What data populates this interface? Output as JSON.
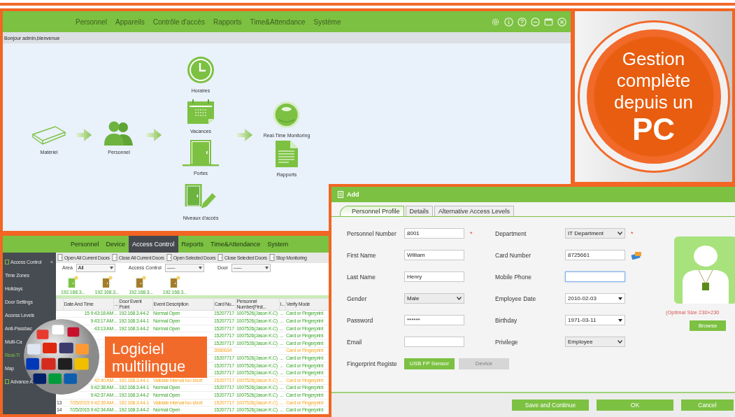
{
  "main_window": {
    "menu": [
      "Personnel",
      "Appareils",
      "Contrôle d'accès",
      "Rapports",
      "Time&Attendance",
      "Système"
    ],
    "greeting": "Bonjour admin,bienvenue",
    "flow_nodes": [
      {
        "label": "Matériel",
        "kind": "device"
      },
      {
        "label": "Personnel",
        "kind": "people"
      },
      {
        "label": "Horaires",
        "kind": "clock"
      },
      {
        "label": "Vacances",
        "kind": "calendar"
      },
      {
        "label": "Portes",
        "kind": "door"
      },
      {
        "label": "Niveaux d'accès",
        "kind": "door-edit"
      },
      {
        "label": "Real-Time Monitoring",
        "kind": "monitor"
      },
      {
        "label": "Rapports",
        "kind": "report"
      }
    ]
  },
  "promo_badge": {
    "text": "Gestion complète depuis un",
    "highlight": "PC"
  },
  "monitor_window": {
    "menu": [
      {
        "label": "Personnel",
        "selected": false
      },
      {
        "label": "Device",
        "selected": false
      },
      {
        "label": "Access Control",
        "selected": true
      },
      {
        "label": "Reports",
        "selected": false
      },
      {
        "label": "Time&Attendance",
        "selected": false
      },
      {
        "label": "System",
        "selected": false
      }
    ],
    "sidebar": [
      {
        "label": "Access Control",
        "kind": "header",
        "toggle": "«",
        "selected": false
      },
      {
        "label": "Time Zones",
        "kind": "item",
        "selected": false
      },
      {
        "label": "Holidays",
        "kind": "item",
        "selected": false
      },
      {
        "label": "Door Settings",
        "kind": "item",
        "selected": false
      },
      {
        "label": "Access Levels",
        "kind": "item",
        "selected": false
      },
      {
        "label": "Anti-Passbac",
        "kind": "item",
        "selected": false
      },
      {
        "label": "Multi-Ca",
        "kind": "item",
        "selected": false
      },
      {
        "label": "Real-Ti",
        "kind": "item",
        "selected": true
      },
      {
        "label": "Map",
        "kind": "item",
        "selected": false
      },
      {
        "label": "Advance A",
        "kind": "header",
        "selected": false
      }
    ],
    "toolbar": [
      "Open All Current Doors",
      "Close All Current Doors",
      "Open Selected Doors",
      "Close Selected Doors",
      "Stop Monitoring"
    ],
    "filters": [
      {
        "label": "Area",
        "value": "All"
      },
      {
        "label": "Access Control",
        "value": "-----"
      },
      {
        "label": "Door",
        "value": "-----"
      }
    ],
    "doors": [
      {
        "label": "192.168.3...",
        "color": "#7cc142"
      },
      {
        "label": "192.168.3...",
        "color": "#a57b2c"
      },
      {
        "label": "192.168.3...",
        "color": "#a57b2c"
      },
      {
        "label": "192.168.3...",
        "color": "#a57b2c"
      }
    ],
    "columns": [
      "Date And Time",
      "...",
      "Door Event Point",
      "Event Description",
      "Card Nu...",
      "Personnel Number(First...",
      "I...",
      "Verify Mode"
    ],
    "rows": [
      {
        "kind": "normal",
        "date": "15 9:43:18 AM",
        "sep": "...",
        "door": "192.168.3.44-2",
        "event": "Normal Open",
        "card": "15207717",
        "person": "1007526(Jason K.C)",
        "flag": "...",
        "verify": "Card or Fingerprint"
      },
      {
        "kind": "normal",
        "date": "9:43:17 AM",
        "sep": "...",
        "door": "192.168.3.44-1",
        "event": "Normal Open",
        "card": "15207717",
        "person": "1007526(Jason K.C)",
        "flag": "...",
        "verify": "Card or Fingerprint"
      },
      {
        "kind": "normal",
        "date": "43:13 AM",
        "sep": "...",
        "door": "192.168.3.44-2",
        "event": "Normal Open",
        "card": "15207717",
        "person": "1007526(Jason K.C)",
        "flag": "...",
        "verify": "Card or Fingerprint"
      },
      {
        "kind": "normal",
        "card": "15207717",
        "person": "1007526(Jason K.C)",
        "flag": "...",
        "verify": "Card or Fingerprint"
      },
      {
        "kind": "normal",
        "card": "15207717",
        "person": "1007526(Jason K.C)",
        "flag": "...",
        "verify": "Card or Fingerprint"
      },
      {
        "kind": "alert",
        "card": "3080634",
        "verify": "Card or Fingerprint"
      },
      {
        "kind": "normal",
        "card": "15207717",
        "person": "1007526(Jason K.C)",
        "flag": "...",
        "verify": "Card or Fingerprint"
      },
      {
        "kind": "normal",
        "card": "15207717",
        "person": "1007526(Jason K.C)",
        "flag": "...",
        "verify": "Card or Fingerprint"
      },
      {
        "kind": "normal",
        "card": "15207717",
        "person": "1007526(Jason K.C)",
        "flag": "...",
        "verify": "Card or Fingerprint"
      },
      {
        "kind": "alert",
        "date": "42:40 AM",
        "sep": "...",
        "door": "192.168.3.44-1",
        "event": "Validate interval too short",
        "card": "15207717",
        "person": "1007526(Jason K.C)",
        "flag": "...",
        "verify": "Card or Fingerprint"
      },
      {
        "kind": "normal",
        "date": "9:42:38 AM",
        "sep": "...",
        "door": "192.168.3.44-1",
        "event": "Normal Open",
        "card": "15207717",
        "person": "1007526(Jason K.C)",
        "flag": "...",
        "verify": "Card or Fingerprint"
      },
      {
        "kind": "normal",
        "date": "9:42:37 AM",
        "sep": "...",
        "door": "192.168.3.44-2",
        "event": "Normal Open",
        "card": "15207717",
        "person": "1007526(Jason K.C)",
        "flag": "...",
        "verify": "Card or Fingerprint"
      },
      {
        "kind": "alert",
        "number": "13",
        "date": "7/25/2015 9:42:35 AM",
        "sep": "...",
        "door": "192.168.3.44-1",
        "event": "Validate interval too short",
        "card": "15207717",
        "person": "1007526(Jason K.C)",
        "flag": "...",
        "verify": "Card or Fingerprint"
      },
      {
        "kind": "normal",
        "number": "14",
        "date": "7/25/2015 9:42:34 AM",
        "sep": "...",
        "door": "192.168.3.44-2",
        "event": "Normal Open",
        "card": "15207717",
        "person": "1007526(Jason K.C)",
        "flag": "...",
        "verify": "Card or Fingerprint"
      }
    ]
  },
  "promo_label": {
    "text": "Logiciel multilingue"
  },
  "dialog": {
    "title": "Add",
    "tabs": [
      {
        "label": "Personnel Profile",
        "selected": true
      },
      {
        "label": "Details",
        "selected": false
      },
      {
        "label": "Alternative  Access Levels",
        "selected": false
      }
    ],
    "left_fields": [
      {
        "label": "Personnel Number",
        "kind": "text",
        "value": "8001",
        "mark": "*"
      },
      {
        "label": "First Name",
        "kind": "text",
        "value": "William"
      },
      {
        "label": "Last Name",
        "kind": "text",
        "value": "Henry"
      },
      {
        "label": "Gender",
        "kind": "select",
        "value": "Male"
      },
      {
        "label": "Password",
        "kind": "text",
        "value": "******"
      },
      {
        "label": "Email",
        "kind": "text"
      },
      {
        "label": "Fingerprint Registe",
        "kind": "buttons",
        "buttons": [
          {
            "label": "USB FP Sensor",
            "disabled": false
          },
          {
            "label": "Device",
            "disabled": true
          }
        ]
      }
    ],
    "right_fields": [
      {
        "label": "Department",
        "kind": "select",
        "value": "IT Department",
        "mark": "*"
      },
      {
        "label": "Card Number",
        "kind": "card",
        "value": "8725661"
      },
      {
        "label": "Mobile Phone",
        "kind": "text",
        "focused": true
      },
      {
        "label": "Employee Date",
        "kind": "date",
        "value": "2010-02-03"
      },
      {
        "label": "Birthday",
        "kind": "date",
        "value": "1971-03-11"
      },
      {
        "label": "Privilege",
        "kind": "select",
        "value": "Employee"
      }
    ],
    "photo": {
      "caption": "(Optimal Size 230×230",
      "button": "Browse"
    },
    "footer_buttons": [
      "Save and Continue",
      "OK",
      "Cancel"
    ]
  }
}
